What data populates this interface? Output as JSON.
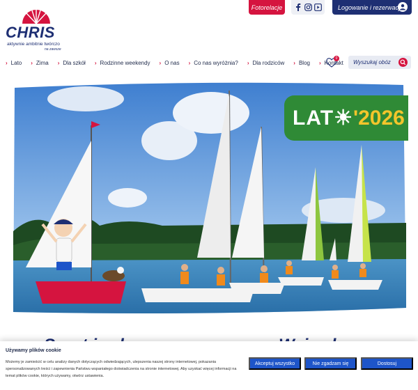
{
  "brand": {
    "name": "CHRIS",
    "tagline": "aktywnie   ambitnie   twórczo",
    "subline": "na zawsze",
    "colors": {
      "navy": "#1e2f73",
      "red": "#d5143f",
      "green": "#2f8a36",
      "yellow": "#f3c52b"
    }
  },
  "topbar": {
    "photo_label": "Fotorelacje",
    "social_icons": [
      "facebook-icon",
      "instagram-icon",
      "youtube-icon"
    ],
    "login_label": "Logowanie i rezerwacje"
  },
  "nav": {
    "items": [
      "Lato",
      "Zima",
      "Dla szkół",
      "Rodzinne weekendy",
      "O nas",
      "Co nas wyróżnia?",
      "Dla rodziców",
      "Blog",
      "Kontakt"
    ],
    "favorites_count": "0",
    "search_placeholder": "Wyszukaj obóz"
  },
  "hero": {
    "badge_word": "LAT☀",
    "badge_year": "'2026",
    "mascot_shirt": "CAMPY CHRIS"
  },
  "peek": {
    "left": "Sport i zabawa",
    "right": "Wyjazdy"
  },
  "cookie": {
    "title": "Używamy plików cookie",
    "text": "Możemy je zamieścić w celu analizy danych dotyczących odwiedzających, ulepszenia naszej strony internetowej, pokazania spersonalizowanych treści i zapewnienia Państwu wspaniałego doświadczenia na stronie internetowej. Aby uzyskać więcej informacji na temat plików cookie, których używamy, otwórz ustawienia.",
    "accept_all": "Akceptuj wszystko",
    "reject": "Nie zgadzam się",
    "settings": "Dostosuj"
  }
}
